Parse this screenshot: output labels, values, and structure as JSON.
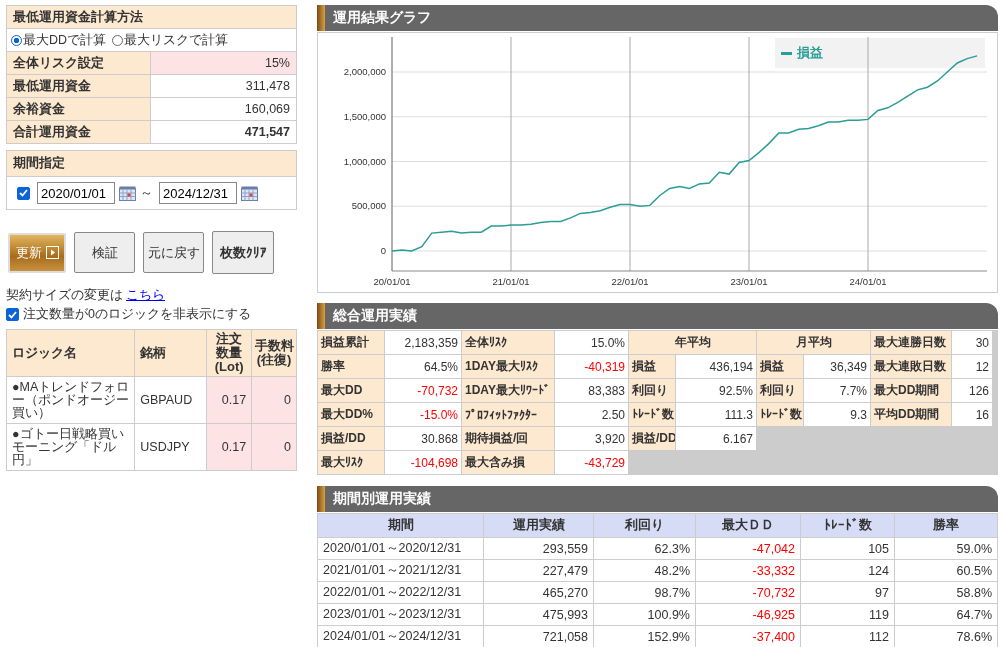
{
  "calc_method": {
    "title": "最低運用資金計算方法",
    "options": [
      {
        "label": "最大DDで計算",
        "selected": true
      },
      {
        "label": "最大リスクで計算",
        "selected": false
      }
    ],
    "rows": [
      {
        "label": "全体リスク設定",
        "value": "15%",
        "kind": "input"
      },
      {
        "label": "最低運用資金",
        "value": "311,478",
        "kind": "plain"
      },
      {
        "label": "余裕資金",
        "value": "160,069",
        "kind": "plain"
      },
      {
        "label": "合計運用資金",
        "value": "471,547",
        "kind": "total"
      }
    ]
  },
  "period": {
    "title": "期間指定",
    "enabled": true,
    "from": "2020/01/01",
    "separator": "～",
    "to": "2024/12/31"
  },
  "buttons": [
    {
      "label": "更新",
      "kind": "primary"
    },
    {
      "label": "検証",
      "kind": "normal"
    },
    {
      "label": "元に戻す",
      "kind": "normal"
    },
    {
      "label": "枚数ｸﾘｱ",
      "kind": "bold"
    }
  ],
  "contract_note": {
    "text": "契約サイズの変更は",
    "link": "こちら"
  },
  "hide_zero": {
    "label": "注文数量が0のロジックを非表示にする",
    "checked": true
  },
  "logic_table": {
    "columns": [
      "ロジック名",
      "銘柄",
      "注文数量(Lot)",
      "手数料(往復)"
    ],
    "rows": [
      {
        "logic": "●MAトレンドフォロー（ポンドオージー買い）",
        "symbol": "GBPAUD",
        "lot": "0.17",
        "fee": "0"
      },
      {
        "logic": "●ゴトー日戦略買いモーニング「ドル円」",
        "symbol": "USDJPY",
        "lot": "0.17",
        "fee": "0"
      }
    ]
  },
  "graph": {
    "title": "運用結果グラフ",
    "chart_data": {
      "type": "line",
      "categories": [
        "20/01/01",
        null,
        null,
        null,
        null,
        null,
        null,
        null,
        null,
        null,
        null,
        null,
        "21/01/01",
        null,
        null,
        null,
        null,
        null,
        null,
        null,
        null,
        null,
        null,
        null,
        "22/01/01",
        null,
        null,
        null,
        null,
        null,
        null,
        null,
        null,
        null,
        null,
        null,
        "23/01/01",
        null,
        null,
        null,
        null,
        null,
        null,
        null,
        null,
        null,
        null,
        null,
        "24/01/01",
        null,
        null,
        null,
        null,
        null,
        null,
        null,
        null,
        null,
        null,
        null
      ],
      "series": [
        {
          "name": "損益",
          "color": "#2a9d95",
          "values": [
            0,
            10000,
            0,
            50000,
            200000,
            210000,
            220000,
            200000,
            210000,
            210000,
            280000,
            280000,
            290000,
            290000,
            300000,
            320000,
            330000,
            330000,
            370000,
            420000,
            430000,
            450000,
            490000,
            520000,
            520000,
            500000,
            510000,
            620000,
            700000,
            720000,
            700000,
            750000,
            760000,
            880000,
            860000,
            990000,
            1010000,
            1100000,
            1200000,
            1320000,
            1320000,
            1360000,
            1370000,
            1400000,
            1440000,
            1440000,
            1460000,
            1460000,
            1470000,
            1570000,
            1600000,
            1660000,
            1730000,
            1800000,
            1830000,
            1900000,
            2000000,
            2100000,
            2150000,
            2180000
          ]
        }
      ],
      "ylim": [
        -223000,
        2391000
      ],
      "grid": true,
      "yticks": [
        {
          "value": 0,
          "label": "0"
        },
        {
          "value": 500000,
          "label": "500,000"
        },
        {
          "value": 1000000,
          "label": "1,000,000"
        },
        {
          "value": 1500000,
          "label": "1,500,000"
        },
        {
          "value": 2000000,
          "label": "2,000,000"
        }
      ]
    }
  },
  "summary": {
    "title": "総合運用実績",
    "groups": [
      {
        "items": [
          {
            "label": "損益累計",
            "value": "2,183,359",
            "negative": false
          },
          {
            "label": "勝率",
            "value": "64.5%",
            "negative": false
          },
          {
            "label": "最大DD",
            "value": "-70,732",
            "negative": true
          },
          {
            "label": "最大DD%",
            "value": "-15.0%",
            "negative": true
          },
          {
            "label": "損益/DD",
            "value": "30.868",
            "negative": false
          },
          {
            "label": "最大ﾘｽｸ",
            "value": "-104,698",
            "negative": true
          }
        ]
      },
      {
        "items": [
          {
            "label": "全体ﾘｽｸ",
            "value": "15.0%",
            "negative": false
          },
          {
            "label": "1DAY最大ﾘｽｸ",
            "value": "-40,319",
            "negative": true
          },
          {
            "label": "1DAY最大ﾘﾜｰﾄﾞ",
            "value": "83,383",
            "negative": false
          },
          {
            "label": "ﾌﾟﾛﾌｨｯﾄﾌｧｸﾀｰ",
            "value": "2.50",
            "negative": false
          },
          {
            "label": "期待損益/回",
            "value": "3,920",
            "negative": false
          },
          {
            "label": "最大含み損",
            "value": "-43,729",
            "negative": true
          }
        ]
      },
      {
        "heading": "年平均",
        "items": [
          {
            "label": "損益",
            "value": "436,194",
            "negative": false
          },
          {
            "label": "利回り",
            "value": "92.5%",
            "negative": false
          },
          {
            "label": "ﾄﾚｰﾄﾞ数",
            "value": "111.3",
            "negative": false
          },
          {
            "label": "損益/DD",
            "value": "6.167",
            "negative": false
          }
        ]
      },
      {
        "heading": "月平均",
        "items": [
          {
            "label": "損益",
            "value": "36,349",
            "negative": false
          },
          {
            "label": "利回り",
            "value": "7.7%",
            "negative": false
          },
          {
            "label": "ﾄﾚｰﾄﾞ数",
            "value": "9.3",
            "negative": false
          }
        ]
      },
      {
        "items": [
          {
            "label": "最大連勝日数",
            "value": "30",
            "negative": false
          },
          {
            "label": "最大連敗日数",
            "value": "12",
            "negative": false
          },
          {
            "label": "最大DD期間",
            "value": "126",
            "negative": false
          },
          {
            "label": "平均DD期間",
            "value": "16",
            "negative": false
          }
        ]
      }
    ]
  },
  "period_results": {
    "title": "期間別運用実績",
    "columns": [
      {
        "label": "期間",
        "negative": false
      },
      {
        "label": "運用実績",
        "negative": false
      },
      {
        "label": "利回り",
        "negative": false
      },
      {
        "label": "最大ＤＤ",
        "negative": true
      },
      {
        "label": "ﾄﾚｰﾄﾞ数",
        "negative": false
      },
      {
        "label": "勝率",
        "negative": false
      }
    ],
    "rows": [
      [
        "2020/01/01～2020/12/31",
        "293,559",
        "62.3%",
        "-47,042",
        "105",
        "59.0%"
      ],
      [
        "2021/01/01～2021/12/31",
        "227,479",
        "48.2%",
        "-33,332",
        "124",
        "60.5%"
      ],
      [
        "2022/01/01～2022/12/31",
        "465,270",
        "98.7%",
        "-70,732",
        "97",
        "58.8%"
      ],
      [
        "2023/01/01～2023/12/31",
        "475,993",
        "100.9%",
        "-46,925",
        "119",
        "64.7%"
      ],
      [
        "2024/01/01～2024/12/31",
        "721,058",
        "152.9%",
        "-37,400",
        "112",
        "78.6%"
      ]
    ]
  }
}
